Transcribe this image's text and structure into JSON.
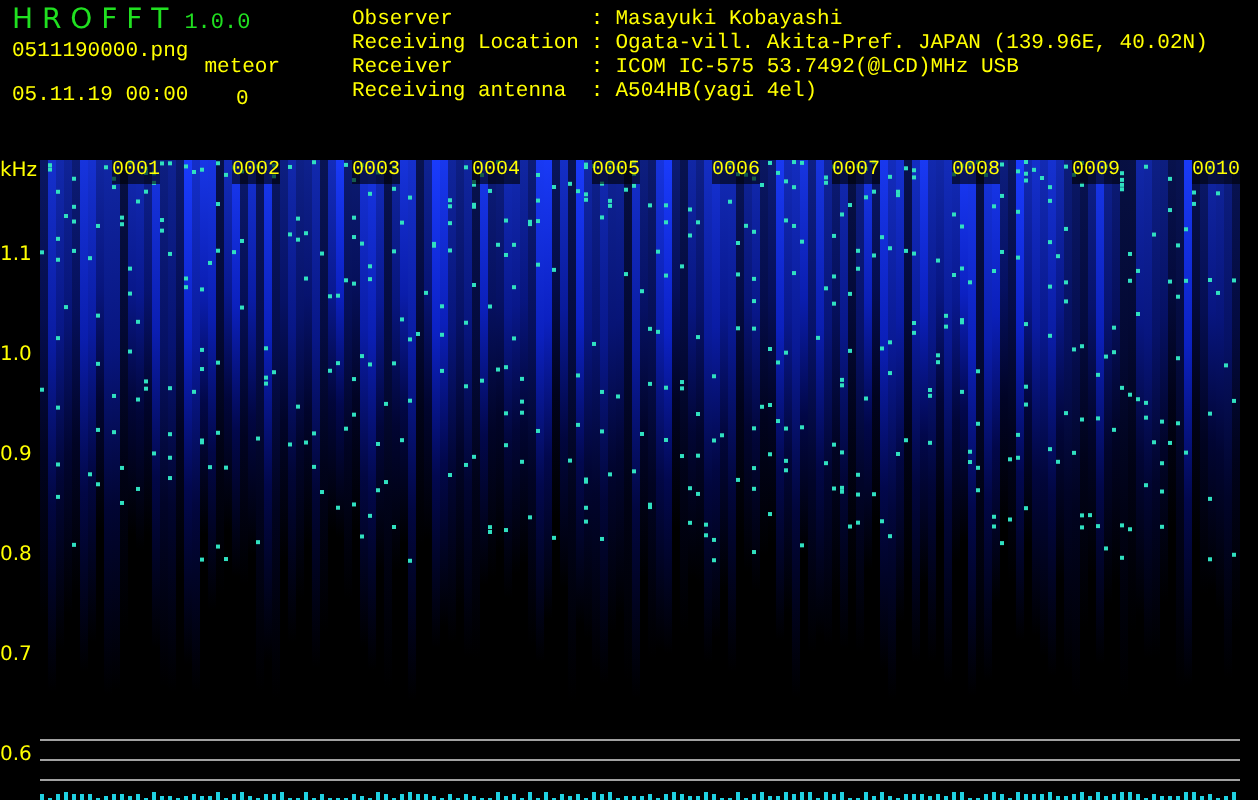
{
  "app": {
    "title": "H R O F F T",
    "version": "1.0.0"
  },
  "file": {
    "name": "0511190000.png",
    "datetime": "05.11.19 00:00"
  },
  "meteor": {
    "label": "meteor",
    "count": "0"
  },
  "info": [
    {
      "label": "Observer",
      "separator": ":",
      "value": "Masayuki Kobayashi"
    },
    {
      "label": "Receiving Location",
      "separator": ":",
      "value": "Ogata-vill. Akita-Pref. JAPAN (139.96E, 40.02N)"
    },
    {
      "label": "Receiver",
      "separator": ":",
      "value": "ICOM IC-575 53.7492(@LCD)MHz USB"
    },
    {
      "label": "Receiving antenna",
      "separator": ":",
      "value": "A504HB(yagi 4el)"
    }
  ],
  "plot": {
    "unit": "kHz",
    "y_labels": [
      "1.1",
      "1.0",
      "0.9",
      "0.8",
      "0.7",
      "0.6"
    ],
    "time_labels": [
      "0001",
      "0002",
      "0003",
      "0004",
      "0005",
      "0006",
      "0007",
      "0008",
      "0009",
      "0010"
    ]
  }
}
